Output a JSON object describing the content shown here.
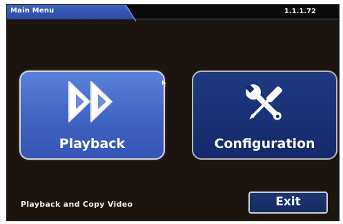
{
  "header": {
    "title": "Main Menu",
    "version": "1.1.1.72"
  },
  "tiles": [
    {
      "label": "Playback",
      "icon": "double-chevron-right-icon",
      "selected": true
    },
    {
      "label": "Configuration",
      "icon": "wrench-screwdriver-icon",
      "selected": false
    }
  ],
  "status": {
    "description": "Playback and Copy Video"
  },
  "footer": {
    "exit_label": "Exit"
  },
  "colors": {
    "background": "#1b140f",
    "accent_blue": "#3f63c2",
    "tile_dark_blue": "#14296a",
    "border": "#d6d6d6",
    "text": "#ffffff"
  }
}
